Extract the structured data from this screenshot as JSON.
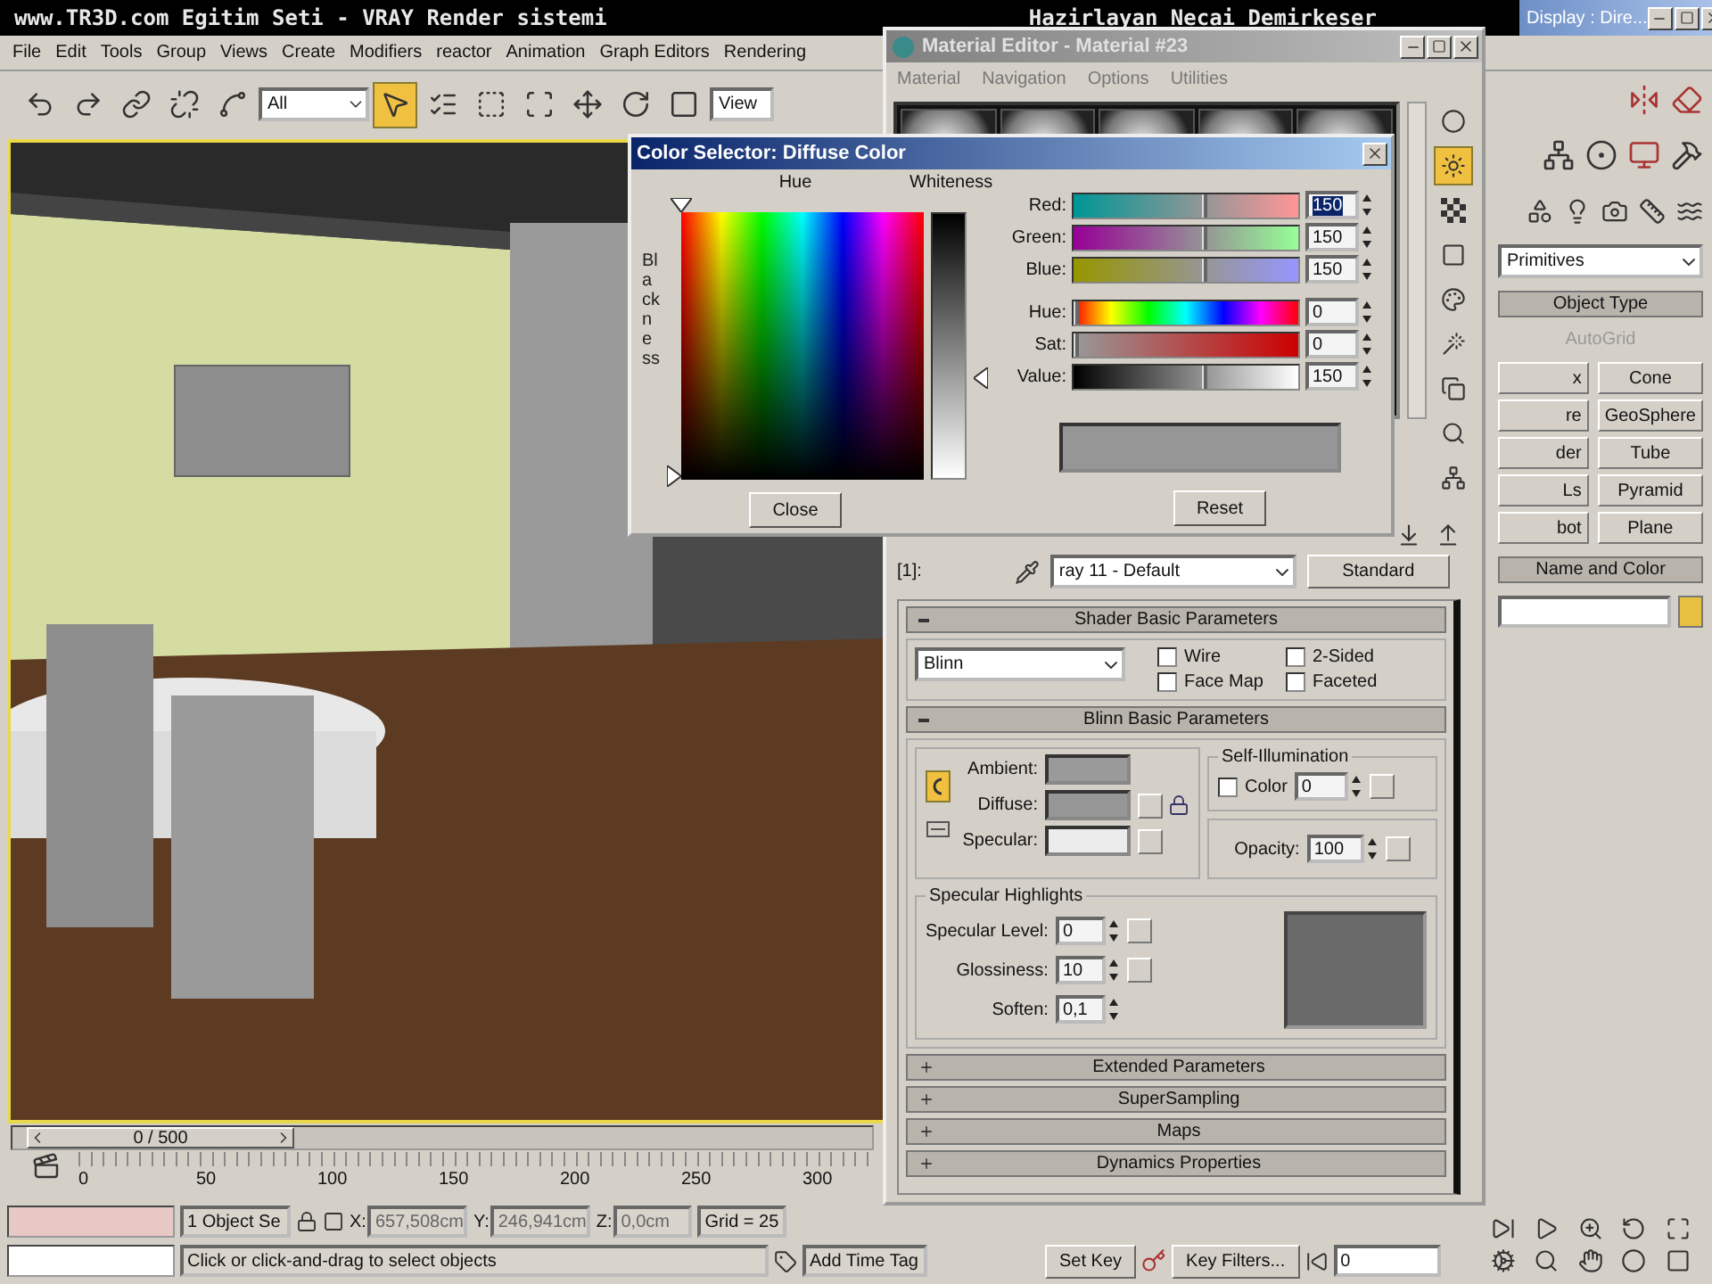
{
  "caption": {
    "left": "www.TR3D.com Egitim Seti -  VRAY Render sistemi",
    "right": "Hazirlayan Necai Demirkeser"
  },
  "main_window": {
    "title": "Display : Dire..."
  },
  "menu": [
    "File",
    "Edit",
    "Tools",
    "Group",
    "Views",
    "Create",
    "Modifiers",
    "reactor",
    "Animation",
    "Graph Editors",
    "Rendering"
  ],
  "toolbar": [
    {
      "kind": "undo",
      "selected": false
    },
    {
      "kind": "redo",
      "selected": false
    },
    {
      "kind": "link",
      "selected": false
    },
    {
      "kind": "unlink",
      "selected": false
    },
    {
      "kind": "bind",
      "selected": false
    },
    {
      "kind": "dropdown",
      "value": "All"
    },
    {
      "kind": "select",
      "selected": true
    },
    {
      "kind": "select_by_name",
      "selected": false
    },
    {
      "kind": "region",
      "selected": false
    },
    {
      "kind": "crossing",
      "selected": false
    },
    {
      "kind": "move",
      "selected": false
    },
    {
      "kind": "rotate",
      "selected": false
    },
    {
      "kind": "scale",
      "selected": false
    },
    {
      "kind": "dropdown",
      "value": "View"
    }
  ],
  "command_panel": {
    "category": "Primitives",
    "object_type": {
      "title": "Object Type",
      "autogrid": {
        "label": "AutoGrid",
        "disabled": true
      },
      "buttons": [
        "x",
        "Cone",
        "re",
        "GeoSphere",
        "der",
        "Tube",
        "Ls",
        "Pyramid",
        "bot",
        "Plane"
      ]
    },
    "name_and_color": {
      "title": "Name and Color"
    }
  },
  "material_editor": {
    "title": "Material Editor - Material #23",
    "menu": [
      "Material",
      "Navigation",
      "Options",
      "Utilities"
    ],
    "side_tools": [
      {
        "kind": "sphere",
        "selected": false
      },
      {
        "kind": "backlight",
        "selected": true
      },
      {
        "kind": "checker",
        "selected": false
      },
      {
        "kind": "background",
        "selected": false
      },
      {
        "kind": "palette",
        "selected": false
      },
      {
        "kind": "wand",
        "selected": false
      },
      {
        "kind": "copy",
        "selected": false
      },
      {
        "kind": "search",
        "selected": false
      },
      {
        "kind": "network",
        "selected": false
      }
    ],
    "slot_label": "[1]:",
    "material_name": "ray 11 - Default",
    "type": "Standard",
    "rollouts": [
      {
        "kind": "shader",
        "title": "Shader Basic Parameters",
        "expanded": true,
        "shader": "Blinn",
        "options": [
          {
            "label": "Wire",
            "checked": false
          },
          {
            "label": "2-Sided",
            "checked": false
          },
          {
            "label": "Face Map",
            "checked": false
          },
          {
            "label": "Faceted",
            "checked": false
          }
        ]
      },
      {
        "kind": "blinn",
        "title": "Blinn Basic Parameters",
        "expanded": true,
        "colors": [
          {
            "label": "Ambient:",
            "color": "#9a9a9a",
            "map": false
          },
          {
            "label": "Diffuse:",
            "color": "#969696",
            "map": true
          },
          {
            "label": "Specular:",
            "color": "#ececec",
            "map": true
          }
        ],
        "self_illumination": {
          "title": "Self-Illumination",
          "label": "Color",
          "checked": false,
          "value": "0"
        },
        "opacity": {
          "label": "Opacity:",
          "value": "100"
        },
        "highlights": {
          "title": "Specular Highlights",
          "fields": [
            {
              "label": "Specular Level:",
              "value": "0"
            },
            {
              "label": "Glossiness:",
              "value": "10"
            },
            {
              "label": "Soften:",
              "value": "0,1"
            }
          ]
        }
      },
      {
        "title": "Extended Parameters",
        "expanded": false
      },
      {
        "title": "SuperSampling",
        "expanded": false
      },
      {
        "title": "Maps",
        "expanded": false
      },
      {
        "title": "Dynamics Properties",
        "expanded": false
      }
    ]
  },
  "color_selector": {
    "title": "Color Selector: Diffuse Color",
    "hue_label": "Hue",
    "whiteness_label": "Whiteness",
    "blackness_label": "Blackness",
    "rgb": [
      {
        "kind": "red",
        "name": "Red:",
        "value": "150",
        "level": 0.59,
        "selected": true
      },
      {
        "kind": "green",
        "name": "Green:",
        "value": "150",
        "level": 0.59,
        "selected": false
      },
      {
        "kind": "blue",
        "name": "Blue:",
        "value": "150",
        "level": 0.59,
        "selected": false
      }
    ],
    "hsv": [
      {
        "kind": "hue",
        "name": "Hue:",
        "value": "0",
        "level": 0,
        "selected": false
      },
      {
        "kind": "sat",
        "name": "Sat:",
        "value": "0",
        "level": 0,
        "selected": false
      },
      {
        "kind": "value",
        "name": "Value:",
        "value": "150",
        "level": 0.59,
        "selected": false
      }
    ],
    "close": "Close",
    "reset": "Reset"
  },
  "time_slider": {
    "label": "0 / 500"
  },
  "ruler": [
    "0",
    "50",
    "100",
    "150",
    "200",
    "250",
    "300"
  ],
  "status": {
    "selection": "1 Object Se",
    "coords": [
      {
        "label": "X:",
        "value": "657,508cm"
      },
      {
        "label": "Y:",
        "value": "246,941cm"
      },
      {
        "label": "Z:",
        "value": "0,0cm"
      }
    ],
    "grid": "Grid = 25",
    "prompt": "Click or click-and-drag to select objects",
    "time_tag": "Add Time Tag",
    "set_key": "Set Key",
    "key_filters": "Key Filters...",
    "frame": "0"
  }
}
